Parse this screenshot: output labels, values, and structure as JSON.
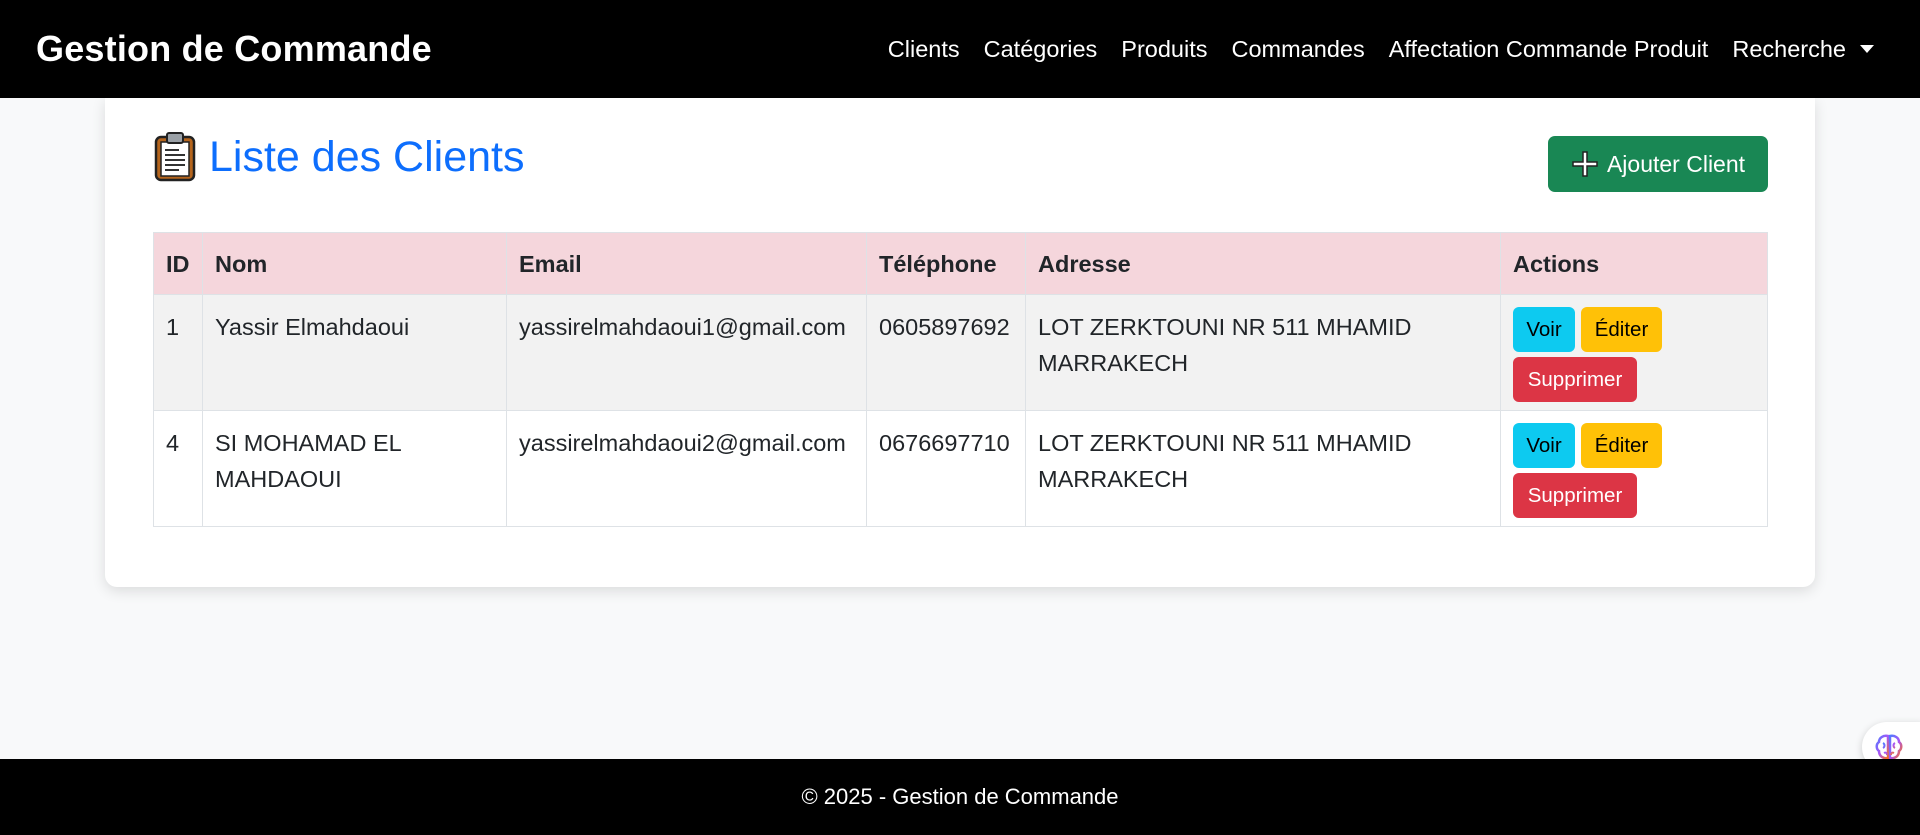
{
  "navbar": {
    "brand": "Gestion de Commande",
    "links": [
      {
        "label": "Clients"
      },
      {
        "label": "Catégories"
      },
      {
        "label": "Produits"
      },
      {
        "label": "Commandes"
      },
      {
        "label": "Affectation Commande Produit"
      }
    ],
    "dropdown_label": "Recherche"
  },
  "page": {
    "title": "Liste des Clients",
    "title_icon": "clipboard-icon",
    "add_button_label": "Ajouter Client",
    "add_button_icon": "plus-icon"
  },
  "table": {
    "headers": [
      "ID",
      "Nom",
      "Email",
      "Téléphone",
      "Adresse",
      "Actions"
    ],
    "rows": [
      {
        "id": "1",
        "nom": "Yassir Elmahdaoui",
        "email": "yassirelmahdaoui1@gmail.com",
        "telephone": "0605897692",
        "adresse": "LOT ZERKTOUNI NR 511 MHAMID MARRAKECH"
      },
      {
        "id": "4",
        "nom": "SI MOHAMAD EL MAHDAOUI",
        "email": "yassirelmahdaoui2@gmail.com",
        "telephone": "0676697710",
        "adresse": "LOT ZERKTOUNI NR 511 MHAMID MARRAKECH"
      }
    ],
    "actions": {
      "view": "Voir",
      "edit": "Éditer",
      "delete": "Supprimer"
    }
  },
  "footer": {
    "text": "© 2025 - Gestion de Commande"
  },
  "colors": {
    "navbar_bg": "#000000",
    "title": "#0d6efd",
    "add_button": "#198754",
    "header_row": "#f5d6dc",
    "view_button": "#0dcaf0",
    "edit_button": "#ffc107",
    "delete_button": "#dc3545"
  },
  "floating_widget_icon": "brain-icon"
}
